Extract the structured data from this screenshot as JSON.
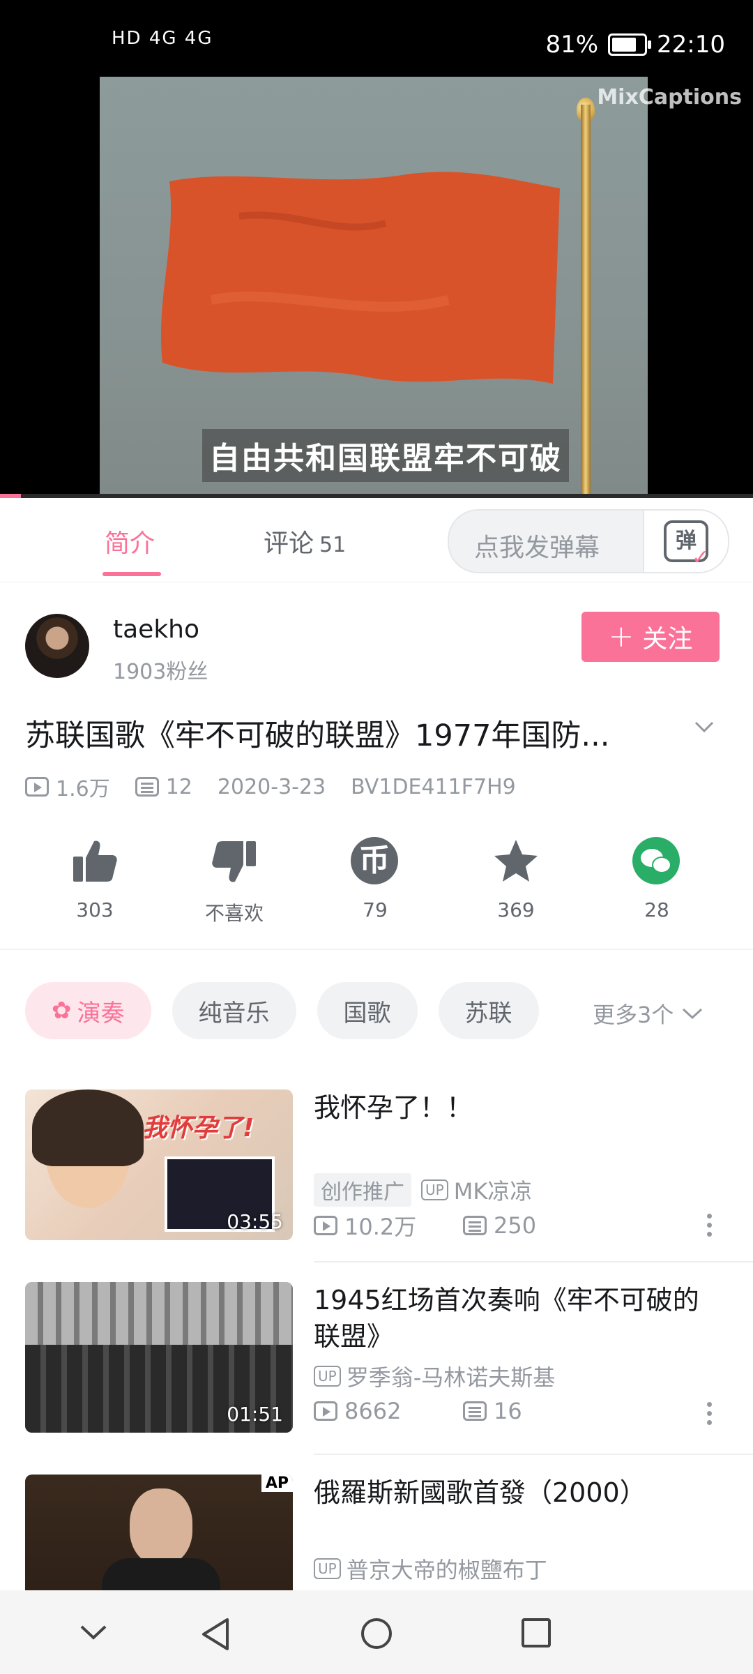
{
  "status_bar": {
    "network_label": "HD 4G 4G",
    "battery": "81%",
    "time": "22:10"
  },
  "player": {
    "subtitle": "自由共和国联盟牢不可破",
    "watermark": "MixCaptions",
    "progress": 0.028
  },
  "tabs": {
    "intro": "简介",
    "comments": "评论",
    "comments_count": "51",
    "danmaku_placeholder": "点我发弹幕",
    "danmaku_button_glyph": "弹"
  },
  "uploader": {
    "name": "taekho",
    "fans": "1903粉丝",
    "follow_label": "关注"
  },
  "video": {
    "title": "苏联国歌《牢不可破的联盟》1977年国防...",
    "views": "1.6万",
    "danmaku_count": "12",
    "date": "2020-3-23",
    "bvid": "BV1DE411F7H9"
  },
  "actions": {
    "like": "303",
    "dislike": "不喜欢",
    "coin": "79",
    "favorite": "369",
    "share": "28"
  },
  "tags": {
    "items": [
      "演奏",
      "纯音乐",
      "国歌",
      "苏联"
    ],
    "more": "更多3个"
  },
  "recommendations": [
    {
      "title": "我怀孕了！！",
      "promo": "创作推广",
      "up": "MK凉凉",
      "views": "10.2万",
      "danmaku": "250",
      "duration": "03:55",
      "thumb_text": "我怀孕了!"
    },
    {
      "title": "1945红场首次奏响《牢不可破的联盟》",
      "up": "罗季翁-马林诺夫斯基",
      "views": "8662",
      "danmaku": "16",
      "duration": "01:51"
    },
    {
      "title": "俄羅斯新國歌首發（2000）",
      "up": "普京大帝的椒鹽布丁",
      "thumb_text": "AP"
    }
  ],
  "up_badge": "UP",
  "colors": {
    "accent": "#fb7299",
    "wechat": "#2aae67"
  }
}
